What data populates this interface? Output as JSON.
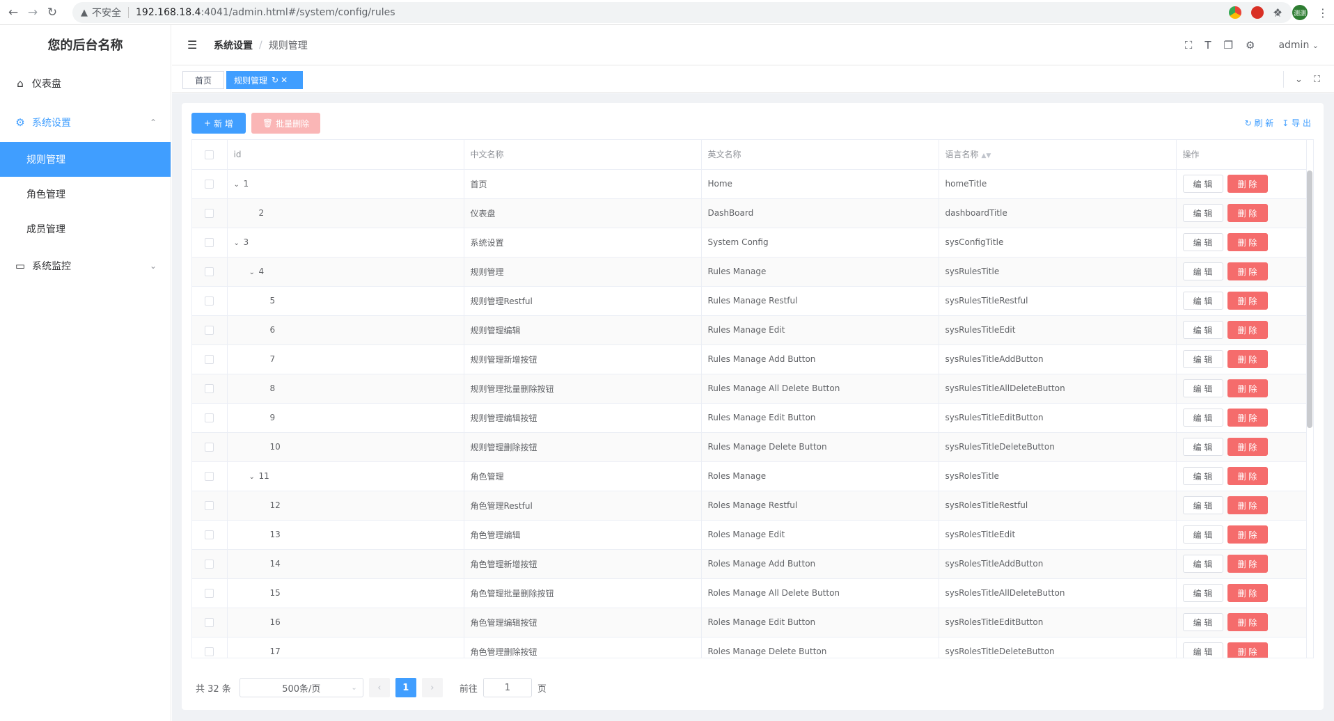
{
  "browser": {
    "insecure_label": "不安全",
    "url_host": "192.168.18.4",
    "url_path": ":4041/admin.html#/system/config/rules",
    "profile_label": "测测"
  },
  "sidebar": {
    "brand": "您的后台名称",
    "items": [
      {
        "label": "仪表盘",
        "icon": "home-icon"
      },
      {
        "label": "系统设置",
        "icon": "gear-icon",
        "open": true,
        "children": [
          {
            "label": "规则管理",
            "active": true
          },
          {
            "label": "角色管理"
          },
          {
            "label": "成员管理"
          }
        ]
      },
      {
        "label": "系统监控",
        "icon": "monitor-icon"
      }
    ]
  },
  "header": {
    "breadcrumb": [
      "系统设置",
      "规则管理"
    ],
    "user": "admin"
  },
  "tags": [
    {
      "label": "首页"
    },
    {
      "label": "规则管理",
      "active": true
    }
  ],
  "toolbar": {
    "add_label": "新 增",
    "batch_delete_label": "批量删除",
    "refresh_label": "刷 新",
    "export_label": "导 出"
  },
  "table": {
    "columns": [
      "id",
      "中文名称",
      "英文名称",
      "语言名称",
      "操作"
    ],
    "edit_label": "编 辑",
    "delete_label": "删 除",
    "rows": [
      {
        "id": "1",
        "level": 0,
        "expandable": true,
        "cn": "首页",
        "en": "Home",
        "lang": "homeTitle"
      },
      {
        "id": "2",
        "level": 1,
        "expandable": false,
        "cn": "仪表盘",
        "en": "DashBoard",
        "lang": "dashboardTitle"
      },
      {
        "id": "3",
        "level": 0,
        "expandable": true,
        "cn": "系统设置",
        "en": "System Config",
        "lang": "sysConfigTitle"
      },
      {
        "id": "4",
        "level": 1,
        "expandable": true,
        "cn": "规则管理",
        "en": "Rules Manage",
        "lang": "sysRulesTitle"
      },
      {
        "id": "5",
        "level": 2,
        "expandable": false,
        "cn": "规则管理Restful",
        "en": "Rules Manage Restful",
        "lang": "sysRulesTitleRestful"
      },
      {
        "id": "6",
        "level": 2,
        "expandable": false,
        "cn": "规则管理编辑",
        "en": "Rules Manage Edit",
        "lang": "sysRulesTitleEdit"
      },
      {
        "id": "7",
        "level": 2,
        "expandable": false,
        "cn": "规则管理新增按钮",
        "en": "Rules Manage Add Button",
        "lang": "sysRulesTitleAddButton"
      },
      {
        "id": "8",
        "level": 2,
        "expandable": false,
        "cn": "规则管理批量删除按钮",
        "en": "Rules Manage All Delete Button",
        "lang": "sysRulesTitleAllDeleteButton"
      },
      {
        "id": "9",
        "level": 2,
        "expandable": false,
        "cn": "规则管理编辑按钮",
        "en": "Rules Manage Edit Button",
        "lang": "sysRulesTitleEditButton"
      },
      {
        "id": "10",
        "level": 2,
        "expandable": false,
        "cn": "规则管理删除按钮",
        "en": "Rules Manage Delete Button",
        "lang": "sysRulesTitleDeleteButton"
      },
      {
        "id": "11",
        "level": 1,
        "expandable": true,
        "cn": "角色管理",
        "en": "Roles Manage",
        "lang": "sysRolesTitle"
      },
      {
        "id": "12",
        "level": 2,
        "expandable": false,
        "cn": "角色管理Restful",
        "en": "Roles Manage Restful",
        "lang": "sysRolesTitleRestful"
      },
      {
        "id": "13",
        "level": 2,
        "expandable": false,
        "cn": "角色管理编辑",
        "en": "Roles Manage Edit",
        "lang": "sysRolesTitleEdit"
      },
      {
        "id": "14",
        "level": 2,
        "expandable": false,
        "cn": "角色管理新增按钮",
        "en": "Roles Manage Add Button",
        "lang": "sysRolesTitleAddButton"
      },
      {
        "id": "15",
        "level": 2,
        "expandable": false,
        "cn": "角色管理批量删除按钮",
        "en": "Roles Manage All Delete Button",
        "lang": "sysRolesTitleAllDeleteButton"
      },
      {
        "id": "16",
        "level": 2,
        "expandable": false,
        "cn": "角色管理编辑按钮",
        "en": "Roles Manage Edit Button",
        "lang": "sysRolesTitleEditButton"
      },
      {
        "id": "17",
        "level": 2,
        "expandable": false,
        "cn": "角色管理删除按钮",
        "en": "Roles Manage Delete Button",
        "lang": "sysRolesTitleDeleteButton"
      }
    ]
  },
  "pagination": {
    "total_label": "共 32 条",
    "page_size": "500条/页",
    "current_page": "1",
    "goto_label": "前往",
    "goto_value": "1",
    "page_suffix": "页"
  },
  "colors": {
    "primary": "#409eff",
    "danger": "#f56c6c",
    "danger_disabled": "#fab6b6"
  }
}
